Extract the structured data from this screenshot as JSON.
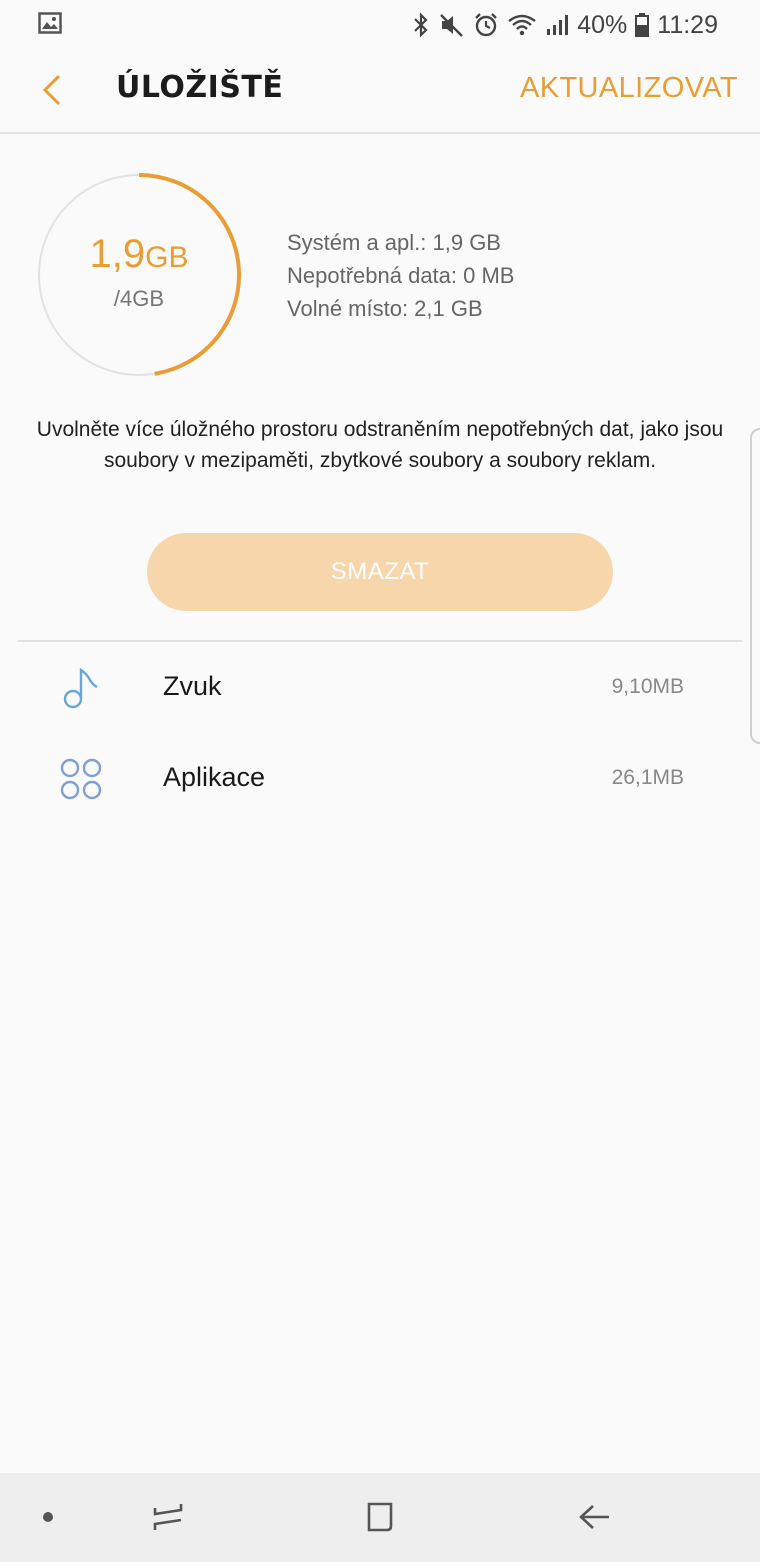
{
  "status_bar": {
    "battery": "40%",
    "time": "11:29",
    "icons": [
      "gallery-icon",
      "bluetooth-icon",
      "mute-icon",
      "alarm-icon",
      "wifi-icon",
      "signal-icon",
      "battery-icon"
    ]
  },
  "header": {
    "title": "ÚLOŽIŠTĚ",
    "action_label": "AKTUALIZOVAT",
    "back_icon": "chevron-left-icon"
  },
  "storage": {
    "used_value": "1,9",
    "used_unit": "GB",
    "total": "/4GB",
    "used_fraction": 0.475,
    "details": [
      "Systém a apl.: 1,9 GB",
      "Nepotřebná data: 0 MB",
      "Volné místo: 2,1 GB"
    ]
  },
  "description": "Uvolněte více úložného prostoru odstraněním nepotřebných dat, jako jsou soubory v mezipaměti, zbytkové soubory a soubory reklam.",
  "clean_button": {
    "label": "SMAZAT"
  },
  "items": [
    {
      "label": "Zvuk",
      "size": "9,10MB",
      "icon": "music-note-icon"
    },
    {
      "label": "Aplikace",
      "size": "26,1MB",
      "icon": "apps-icon"
    }
  ],
  "nav": {
    "icons": [
      "dot-icon",
      "recents-icon",
      "home-icon",
      "back-arrow-icon"
    ]
  },
  "colors": {
    "accent": "#eb9d34",
    "accent_disabled": "#f7d6ab",
    "ring_track": "#e2e2e2",
    "music_icon": "#6aa7d6",
    "apps_icon": "#7f9fd6"
  }
}
